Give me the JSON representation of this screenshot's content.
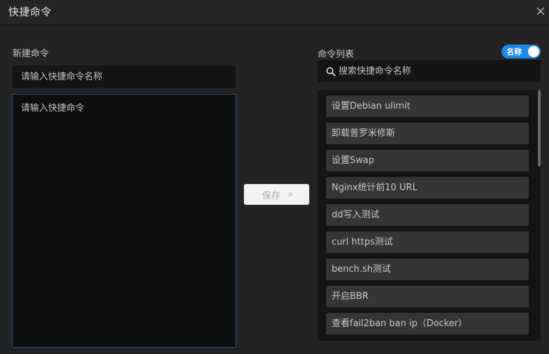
{
  "dialog": {
    "title": "快捷命令"
  },
  "left": {
    "section_label": "新建命令",
    "name_placeholder": "请输入快捷命令名称",
    "command_placeholder": "请输入快捷命令"
  },
  "save_button": {
    "label": "保存",
    "arrows": "»"
  },
  "right": {
    "section_label": "命令列表",
    "sort_toggle": {
      "label": "名称",
      "on": true,
      "color": "#1f87e8"
    },
    "search_placeholder": "搜索快捷命令名称",
    "items": [
      {
        "label": "设置Debian ulimit"
      },
      {
        "label": "卸载普罗米修斯"
      },
      {
        "label": "设置Swap"
      },
      {
        "label": "Nginx统计前10 URL"
      },
      {
        "label": "dd写入测试"
      },
      {
        "label": "curl https测试"
      },
      {
        "label": "bench.sh测试"
      },
      {
        "label": "开启BBR"
      },
      {
        "label": "查看fail2ban ban ip（Docker）"
      }
    ]
  }
}
